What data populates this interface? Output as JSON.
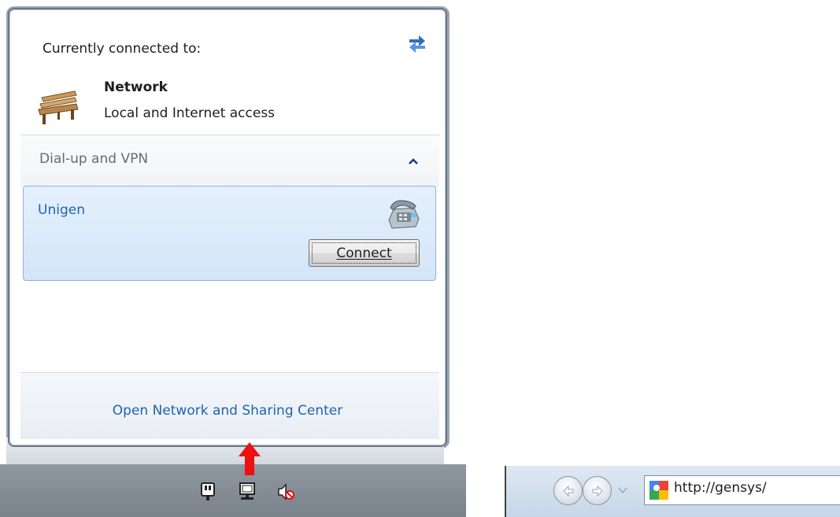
{
  "flyout": {
    "header": "Currently connected to:",
    "network_name": "Network",
    "network_status": "Local and Internet access",
    "section_title": "Dial-up and VPN",
    "vpn_connection_name": "Unigen",
    "connect_button_label": "Connect",
    "footer_link": "Open Network and Sharing Center",
    "icons": {
      "refresh": "refresh-arrows-icon",
      "network": "park-bench-network-icon",
      "collapse": "chevron-up-icon",
      "dialup": "telephone-modem-icon"
    }
  },
  "annotation": {
    "arrow_color": "#ee1111"
  },
  "tray": {
    "icons": [
      "power-plug-icon",
      "network-monitor-icon",
      "speaker-muted-icon"
    ]
  },
  "browser": {
    "url": "http://gensys/",
    "icons": [
      "back-arrow-icon",
      "forward-arrow-icon",
      "history-dropdown-icon",
      "google-favicon-icon"
    ]
  },
  "colors": {
    "link": "#1d63b5",
    "selection_bg": "#dcebfa"
  }
}
